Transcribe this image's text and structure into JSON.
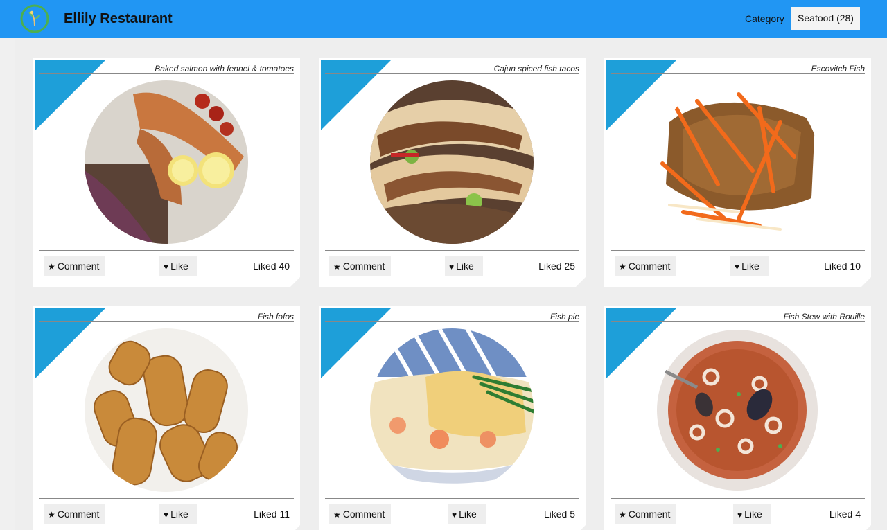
{
  "header": {
    "app_title": "Ellily Restaurant",
    "logo_icon": "leaf-logo-icon",
    "category_label": "Category",
    "category_value": "Seafood (28)"
  },
  "colors": {
    "header_bg": "#2196f3",
    "accent_triangle": "#1e9fd9",
    "card_bg": "#ffffff",
    "page_bg": "#eeeeee"
  },
  "icons": {
    "comment": "★",
    "like": "♥"
  },
  "cards": [
    {
      "title": "Baked salmon with fennel & tomatoes",
      "comment_label": "Comment",
      "like_label": "Like",
      "liked_text": "Liked 40"
    },
    {
      "title": "Cajun spiced fish tacos",
      "comment_label": "Comment",
      "like_label": "Like",
      "liked_text": "Liked 25"
    },
    {
      "title": "Escovitch Fish",
      "comment_label": "Comment",
      "like_label": "Like",
      "liked_text": "Liked 10"
    },
    {
      "title": "Fish fofos",
      "comment_label": "Comment",
      "like_label": "Like",
      "liked_text": "Liked 11"
    },
    {
      "title": "Fish pie",
      "comment_label": "Comment",
      "like_label": "Like",
      "liked_text": "Liked 5"
    },
    {
      "title": "Fish Stew with Rouille",
      "comment_label": "Comment",
      "like_label": "Like",
      "liked_text": "Liked 4"
    }
  ]
}
